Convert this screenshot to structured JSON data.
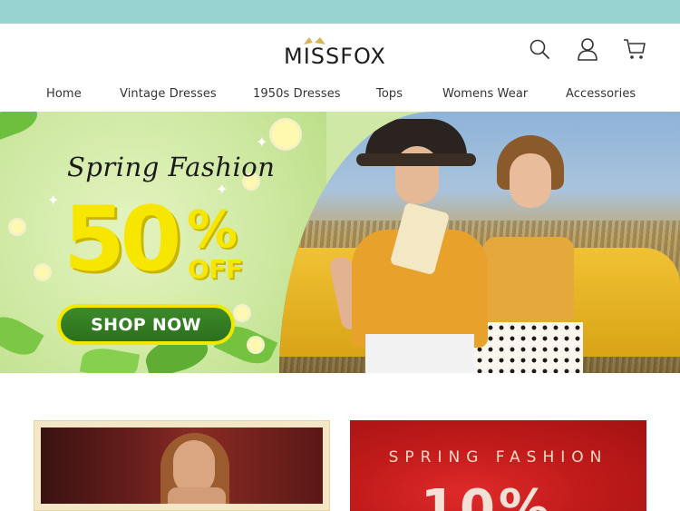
{
  "brand": {
    "logo_text": "MISSFOX"
  },
  "colors": {
    "topbar": "#98d3d2",
    "accent_yellow": "#f6e600",
    "shop_button_green": "#2c6f1c",
    "promo_red": "#c21b1b"
  },
  "header": {
    "icons": [
      "search-icon",
      "user-icon",
      "cart-icon"
    ]
  },
  "nav": {
    "items": [
      {
        "label": "Home"
      },
      {
        "label": "Vintage Dresses"
      },
      {
        "label": "1950s Dresses"
      },
      {
        "label": "Tops"
      },
      {
        "label": "Womens Wear"
      },
      {
        "label": "Accessories"
      }
    ]
  },
  "hero": {
    "title": "Spring Fashion",
    "discount_number": "50",
    "discount_sign": "%",
    "discount_off": "OFF",
    "cta_label": "SHOP NOW"
  },
  "promo_cards": {
    "right_heading": "SPRING FASHION",
    "right_partial": "10%"
  }
}
